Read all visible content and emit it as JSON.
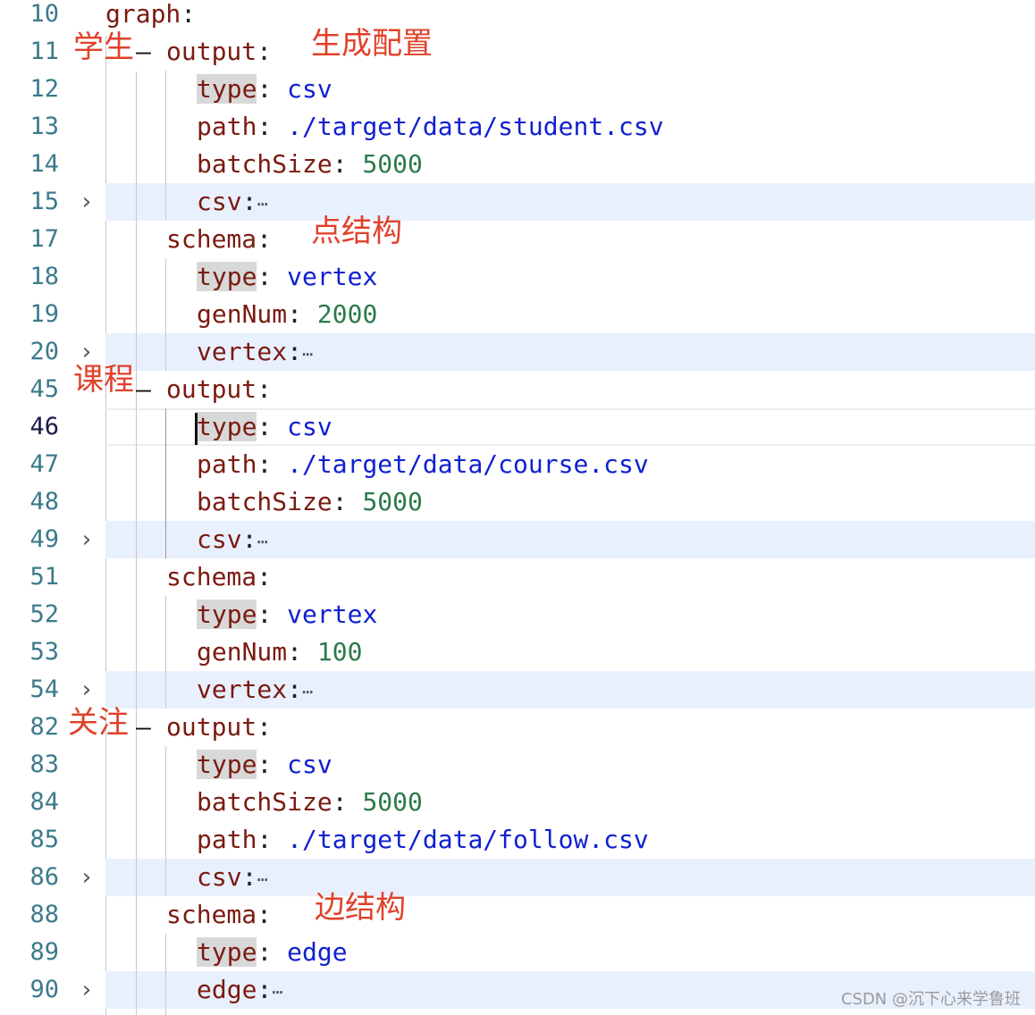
{
  "lines": [
    {
      "ln": "10",
      "fold": false,
      "parts": [
        {
          "c": "k",
          "t": "graph"
        },
        {
          "c": "p",
          "t": ":"
        }
      ]
    },
    {
      "ln": "11",
      "fold": false,
      "parts": [
        {
          "c": "k",
          "t": "output"
        },
        {
          "c": "p",
          "t": ":"
        }
      ]
    },
    {
      "ln": "12",
      "fold": false,
      "parts": [
        {
          "c": "k hl",
          "t": "type"
        },
        {
          "c": "p",
          "t": ": "
        },
        {
          "c": "s",
          "t": "csv"
        }
      ]
    },
    {
      "ln": "13",
      "fold": false,
      "parts": [
        {
          "c": "k",
          "t": "path"
        },
        {
          "c": "p",
          "t": ": "
        },
        {
          "c": "s",
          "t": "./target/data/student.csv"
        }
      ]
    },
    {
      "ln": "14",
      "fold": false,
      "parts": [
        {
          "c": "k",
          "t": "batchSize"
        },
        {
          "c": "p",
          "t": ": "
        },
        {
          "c": "n",
          "t": "5000"
        }
      ]
    },
    {
      "ln": "15",
      "fold": true,
      "parts": [
        {
          "c": "k",
          "t": "csv"
        },
        {
          "c": "p",
          "t": ":"
        },
        {
          "c": "ell",
          "t": "⋯"
        }
      ]
    },
    {
      "ln": "17",
      "fold": false,
      "parts": [
        {
          "c": "k",
          "t": "schema"
        },
        {
          "c": "p",
          "t": ":"
        }
      ]
    },
    {
      "ln": "18",
      "fold": false,
      "parts": [
        {
          "c": "k hl",
          "t": "type"
        },
        {
          "c": "p",
          "t": ": "
        },
        {
          "c": "s",
          "t": "vertex"
        }
      ]
    },
    {
      "ln": "19",
      "fold": false,
      "parts": [
        {
          "c": "k",
          "t": "genNum"
        },
        {
          "c": "p",
          "t": ": "
        },
        {
          "c": "n",
          "t": "2000"
        }
      ]
    },
    {
      "ln": "20",
      "fold": true,
      "parts": [
        {
          "c": "k",
          "t": "vertex"
        },
        {
          "c": "p",
          "t": ":"
        },
        {
          "c": "ell",
          "t": "⋯"
        }
      ]
    },
    {
      "ln": "45",
      "fold": false,
      "parts": [
        {
          "c": "k",
          "t": "output"
        },
        {
          "c": "p",
          "t": ":"
        }
      ]
    },
    {
      "ln": "46",
      "fold": false,
      "current": true,
      "parts": [
        {
          "c": "k hl",
          "t": "type"
        },
        {
          "c": "p",
          "t": ": "
        },
        {
          "c": "s",
          "t": "csv"
        }
      ]
    },
    {
      "ln": "47",
      "fold": false,
      "parts": [
        {
          "c": "k",
          "t": "path"
        },
        {
          "c": "p",
          "t": ": "
        },
        {
          "c": "s",
          "t": "./target/data/course.csv"
        }
      ]
    },
    {
      "ln": "48",
      "fold": false,
      "parts": [
        {
          "c": "k",
          "t": "batchSize"
        },
        {
          "c": "p",
          "t": ": "
        },
        {
          "c": "n",
          "t": "5000"
        }
      ]
    },
    {
      "ln": "49",
      "fold": true,
      "parts": [
        {
          "c": "k",
          "t": "csv"
        },
        {
          "c": "p",
          "t": ":"
        },
        {
          "c": "ell",
          "t": "⋯"
        }
      ]
    },
    {
      "ln": "51",
      "fold": false,
      "parts": [
        {
          "c": "k",
          "t": "schema"
        },
        {
          "c": "p",
          "t": ":"
        }
      ]
    },
    {
      "ln": "52",
      "fold": false,
      "parts": [
        {
          "c": "k hl",
          "t": "type"
        },
        {
          "c": "p",
          "t": ": "
        },
        {
          "c": "s",
          "t": "vertex"
        }
      ]
    },
    {
      "ln": "53",
      "fold": false,
      "parts": [
        {
          "c": "k",
          "t": "genNum"
        },
        {
          "c": "p",
          "t": ": "
        },
        {
          "c": "n",
          "t": "100"
        }
      ]
    },
    {
      "ln": "54",
      "fold": true,
      "parts": [
        {
          "c": "k",
          "t": "vertex"
        },
        {
          "c": "p",
          "t": ":"
        },
        {
          "c": "ell",
          "t": "⋯"
        }
      ]
    },
    {
      "ln": "82",
      "fold": false,
      "parts": [
        {
          "c": "k",
          "t": "output"
        },
        {
          "c": "p",
          "t": ":"
        }
      ]
    },
    {
      "ln": "83",
      "fold": false,
      "parts": [
        {
          "c": "k hl",
          "t": "type"
        },
        {
          "c": "p",
          "t": ": "
        },
        {
          "c": "s",
          "t": "csv"
        }
      ]
    },
    {
      "ln": "84",
      "fold": false,
      "parts": [
        {
          "c": "k",
          "t": "batchSize"
        },
        {
          "c": "p",
          "t": ": "
        },
        {
          "c": "n",
          "t": "5000"
        }
      ]
    },
    {
      "ln": "85",
      "fold": false,
      "parts": [
        {
          "c": "k",
          "t": "path"
        },
        {
          "c": "p",
          "t": ": "
        },
        {
          "c": "s",
          "t": "./target/data/follow.csv"
        }
      ]
    },
    {
      "ln": "86",
      "fold": true,
      "parts": [
        {
          "c": "k",
          "t": "csv"
        },
        {
          "c": "p",
          "t": ":"
        },
        {
          "c": "ell",
          "t": "⋯"
        }
      ]
    },
    {
      "ln": "88",
      "fold": false,
      "parts": [
        {
          "c": "k",
          "t": "schema"
        },
        {
          "c": "p",
          "t": ":"
        }
      ]
    },
    {
      "ln": "89",
      "fold": false,
      "parts": [
        {
          "c": "k hl",
          "t": "type"
        },
        {
          "c": "p",
          "t": ": "
        },
        {
          "c": "s",
          "t": "edge"
        }
      ]
    },
    {
      "ln": "90",
      "fold": true,
      "parts": [
        {
          "c": "k",
          "t": "edge"
        },
        {
          "c": "p",
          "t": ":"
        },
        {
          "c": "ell",
          "t": "⋯"
        }
      ]
    }
  ],
  "annotations": {
    "student": "学生",
    "gen_config": "生成配置",
    "vertex_schema": "点结构",
    "course": "课程",
    "follow": "关注",
    "edge_schema": "边结构"
  },
  "dash": "–",
  "watermark": "CSDN @沉下心来学鲁班"
}
